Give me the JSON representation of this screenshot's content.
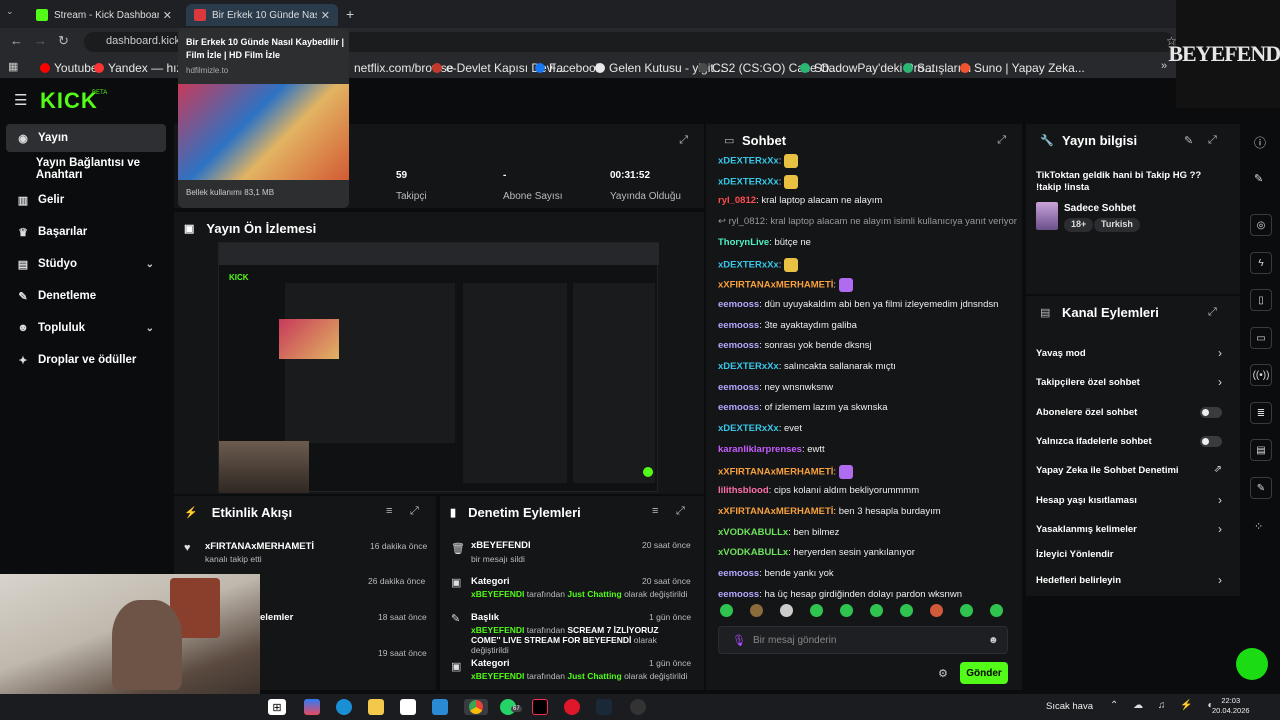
{
  "browser": {
    "tabs": [
      {
        "title": "Stream - Kick Dashboard"
      },
      {
        "title": "Bir Erkek 10 Günde Nasıl Kaybe..."
      }
    ],
    "address": "dashboard.kick.co",
    "bookmarks": [
      "Youtube",
      "Yandex — hızlı İnter",
      "netflix.com/browse",
      "e-Devlet Kapısı Devl...",
      "Facebook",
      "Gelen Kutusu - yigit...",
      "CS2 (CS:GO) Case O...",
      "ShadowPay'deki Pro...",
      "Satışlarım",
      "Suno | Yapay Zeka..."
    ],
    "tooltip": {
      "title": "Bir Erkek 10 Günde Nasıl Kaybedilir | Film İzle | HD Film İzle",
      "url": "hdfilmizle.to",
      "memory": "Bellek kullanımı 83,1 MB"
    }
  },
  "logo_text": "BEYEFENDI",
  "kick": {
    "logo": "KICK",
    "beta": "BETA"
  },
  "sidebar": {
    "items": [
      {
        "label": "Yayın"
      },
      {
        "label": "Yayın Bağlantısı ve Anahtarı"
      },
      {
        "label": "Gelir"
      },
      {
        "label": "Başarılar"
      },
      {
        "label": "Stüdyo"
      },
      {
        "label": "Denetleme"
      },
      {
        "label": "Topluluk"
      },
      {
        "label": "Droplar ve ödüller"
      }
    ]
  },
  "stats": [
    {
      "value": "59",
      "label": "Takipçi"
    },
    {
      "value": "-",
      "label": "Abone Sayısı"
    },
    {
      "value": "00:31:52",
      "label": "Yayında Olduğu"
    }
  ],
  "preview": {
    "title": "Yayın Ön İzlemesi"
  },
  "activity": {
    "title": "Etkinlik Akışı",
    "events": [
      {
        "name": "xFIRTANAxMERHAMETİ",
        "sub": "kanalı takip etti",
        "time": "16 dakika önce"
      },
      {
        "name": "",
        "sub": "",
        "time": "26 dakika önce"
      },
      {
        "name": "elemler",
        "sub": "",
        "time": "18 saat önce"
      },
      {
        "name": "",
        "sub": "",
        "time": "19 saat önce"
      }
    ]
  },
  "moderation": {
    "title": "Denetim Eylemleri",
    "events": [
      {
        "name": "xBEYEFENDI",
        "sub": "bir mesajı sildi",
        "time": "20 saat önce"
      },
      {
        "name": "Kategori",
        "user": "xBEYEFENDI",
        "mid": " tarafından ",
        "green2": "Just Chatting",
        "sub": " olarak değiştirildi",
        "time": "20 saat önce"
      },
      {
        "name": "Başlık",
        "user": "xBEYEFENDI",
        "mid": " tarafından ",
        "bold": "SCREAM 7 İZLİYORUZ COME'' LIVE STREAM FOR BEYEFENDİ",
        "sub": " olarak değiştirildi",
        "time": "1 gün önce"
      },
      {
        "name": "Kategori",
        "user": "xBEYEFENDI",
        "mid": " tarafından ",
        "green2": "Just Chatting",
        "sub": " olarak değiştirildi",
        "time": "1 gün önce"
      }
    ]
  },
  "chat": {
    "title": "Sohbet",
    "placeholder": "Bir mesaj gönderin",
    "send": "Gönder",
    "messages": [
      {
        "user": "xDEXTERxXx",
        "text": "",
        "color": "#38c7e8"
      },
      {
        "user": "xDEXTERxXx",
        "text": "",
        "color": "#38c7e8"
      },
      {
        "user": "ryl_0812",
        "text": "kral laptop alacam ne alayım",
        "color": "#ff4d4d"
      },
      {
        "user": "ryl_0812",
        "text": "kral laptop alacam ne alayım isimli kullanıcıya yanıt veriyor",
        "color": "#999",
        "reply": true
      },
      {
        "user": "ThorynLive",
        "text": "bütçe ne",
        "color": "#4df0c2"
      },
      {
        "user": "xDEXTERxXx",
        "text": "",
        "color": "#38c7e8"
      },
      {
        "user": "xXFIRTANAxMERHAMETİ",
        "text": "",
        "color": "#f7a03c"
      },
      {
        "user": "eemooss",
        "text": "dün uyuyakaldım abi ben ya filmi izleyemedim jdnsndsn",
        "color": "#b4a8ff"
      },
      {
        "user": "eemooss",
        "text": "3te ayaktaydım galiba",
        "color": "#b4a8ff"
      },
      {
        "user": "eemooss",
        "text": "sonrası yok bende dksnsj",
        "color": "#b4a8ff"
      },
      {
        "user": "xDEXTERxXx",
        "text": "salıncakta sallanarak mıçtı",
        "color": "#38c7e8"
      },
      {
        "user": "eemooss",
        "text": "ney wnsnwksnw",
        "color": "#b4a8ff"
      },
      {
        "user": "eemooss",
        "text": "of izlemem lazım ya skwnska",
        "color": "#b4a8ff"
      },
      {
        "user": "xDEXTERxXx",
        "text": "evet",
        "color": "#38c7e8"
      },
      {
        "user": "karanliklarprenses",
        "text": "ewtt",
        "color": "#c75cff"
      },
      {
        "user": "xXFIRTANAxMERHAMETİ",
        "text": "",
        "color": "#f7a03c"
      },
      {
        "user": "lilithsblood",
        "text": "cips kolanıi aldım bekliyorummmm",
        "color": "#ff6fa8"
      },
      {
        "user": "xXFIRTANAxMERHAMETİ",
        "text": "ben 3 hesapla burdayım",
        "color": "#f7a03c"
      },
      {
        "user": "xVODKABULLx",
        "text": "ben bilmez",
        "color": "#6ee35b"
      },
      {
        "user": "xVODKABULLx",
        "text": "heryerden sesin yankılanıyor",
        "color": "#6ee35b"
      },
      {
        "user": "eemooss",
        "text": "bende yankı yok",
        "color": "#b4a8ff"
      },
      {
        "user": "eemooss",
        "text": "ha üç hesap girdiğinden dolayı pardon wksnwn",
        "color": "#b4a8ff"
      }
    ]
  },
  "stream_info": {
    "title_label": "Yayın bilgisi",
    "stream_title": "TikToktan geldik hani bi Takip HG ?? !takip !insta",
    "category": "Sadece Sohbet",
    "tags": [
      "18+",
      "Turkish"
    ]
  },
  "channel_actions": {
    "title": "Kanal Eylemleri",
    "items": [
      {
        "label": "Yavaş mod",
        "ctrl": "chev"
      },
      {
        "label": "Takipçilere özel sohbet",
        "ctrl": "chev"
      },
      {
        "label": "Abonelere özel sohbet",
        "ctrl": "toggle"
      },
      {
        "label": "Yalnızca ifadelerle sohbet",
        "ctrl": "toggle"
      },
      {
        "label": "Yapay Zeka ile Sohbet Denetimi",
        "ctrl": "ext"
      },
      {
        "label": "Hesap yaşı kısıtlaması",
        "ctrl": "chev"
      },
      {
        "label": "Yasaklanmış kelimeler",
        "ctrl": "chev"
      },
      {
        "label": "İzleyici Yönlendir",
        "ctrl": "none"
      },
      {
        "label": "Hedefleri belirleyin",
        "ctrl": "chev"
      }
    ]
  },
  "taskbar": {
    "weather": "Sıcak hava",
    "time": "22:03",
    "date": "20.04.2026",
    "badge": "67"
  }
}
